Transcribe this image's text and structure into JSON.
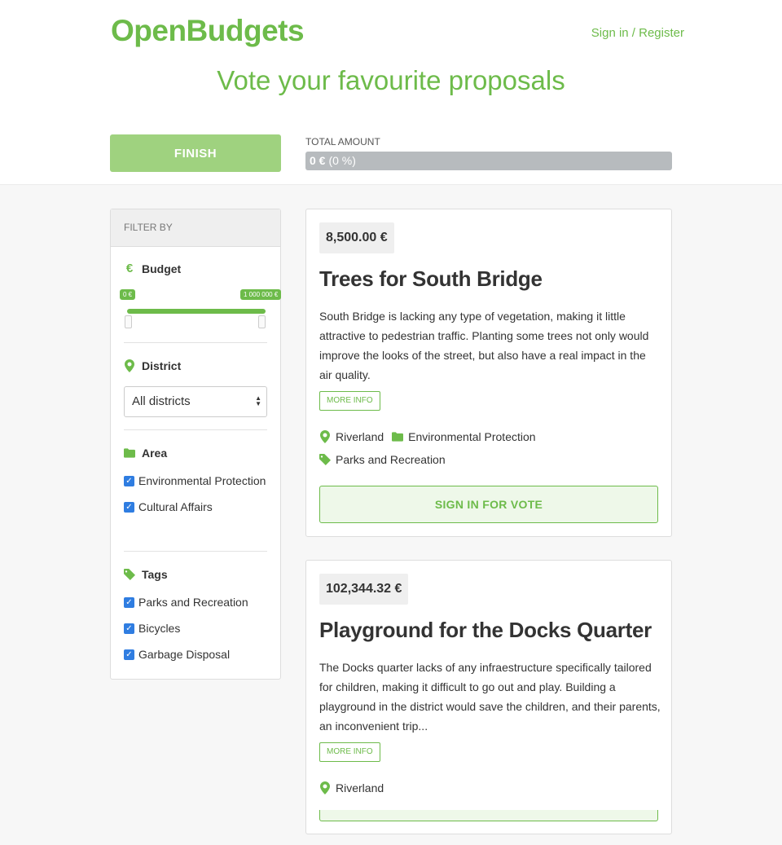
{
  "header": {
    "logo": "OpenBudgets",
    "signin": "Sign in / Register",
    "tagline": "Vote your favourite proposals",
    "finish_label": "FINISH",
    "total_label": "TOTAL AMOUNT",
    "total_amount": "0 €",
    "total_percent": "(0 %)"
  },
  "filter": {
    "title": "FILTER BY",
    "budget": {
      "label": "Budget",
      "icon": "euro-icon",
      "min_label": "0 €",
      "max_label": "1 000 000 €"
    },
    "district": {
      "label": "District",
      "icon": "map-marker-icon",
      "selected": "All districts"
    },
    "area": {
      "label": "Area",
      "icon": "folder-icon",
      "options": [
        {
          "label": "Environmental Protection",
          "checked": true
        },
        {
          "label": "Cultural Affairs",
          "checked": true
        }
      ]
    },
    "tags": {
      "label": "Tags",
      "icon": "tag-icon",
      "options": [
        {
          "label": "Parks and Recreation",
          "checked": true
        },
        {
          "label": "Bicycles",
          "checked": true
        },
        {
          "label": "Garbage Disposal",
          "checked": true
        }
      ]
    }
  },
  "proposals": [
    {
      "price": "8,500.00 €",
      "title": "Trees for South Bridge",
      "description": "South Bridge is lacking any type of vegetation, making it little attractive to pedestrian traffic. Planting some trees not only would improve the looks of the street, but also have a real impact in the air quality.",
      "more_info": "MORE INFO",
      "district": "Riverland",
      "area": "Environmental Protection",
      "tag": "Parks and Recreation",
      "vote_label": "SIGN IN FOR VOTE"
    },
    {
      "price": "102,344.32 €",
      "title": "Playground for the Docks Quarter",
      "description": "The Docks quarter lacks of any infraestructure specifically tailored for children, making it difficult to go out and play. Building a playground in the district would save the children, and their parents, an inconvenient trip...",
      "more_info": "MORE INFO",
      "district": "Riverland"
    }
  ],
  "colors": {
    "brand_green": "#6dbb4a",
    "finish_green": "#9fd27f",
    "checkbox_blue": "#2f7de1"
  }
}
